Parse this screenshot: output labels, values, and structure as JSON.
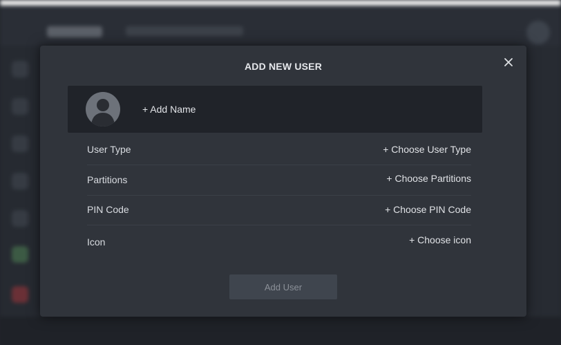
{
  "modal": {
    "title": "ADD NEW USER",
    "close_icon": "close-icon",
    "name_row": {
      "avatar_icon": "user-avatar-icon",
      "add_name_label": "+ Add Name"
    },
    "fields": [
      {
        "label": "User Type",
        "action": "+ Choose User Type"
      },
      {
        "label": "Partitions",
        "action": "+ Choose Partitions"
      },
      {
        "label": "PIN Code",
        "action": "+ Choose PIN Code"
      },
      {
        "label": "Icon",
        "action": "+ Choose icon"
      }
    ],
    "submit_label": "Add User"
  },
  "colors": {
    "modal_bg": "#30343b",
    "name_row_bg": "#202329",
    "button_bg": "#3f454e",
    "button_text_disabled": "#8c9199"
  }
}
